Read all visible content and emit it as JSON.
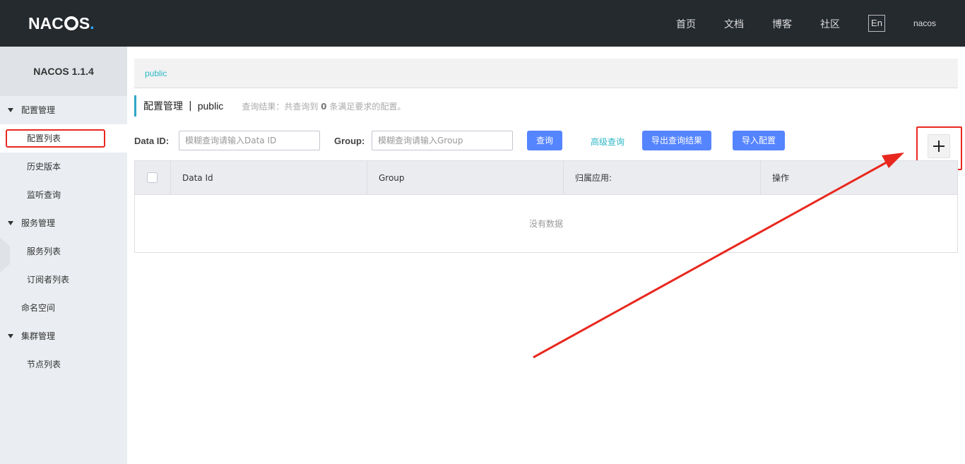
{
  "header": {
    "logo": {
      "n": "N",
      "a": "A",
      "c": "C",
      "s": "S",
      "dot": "."
    },
    "nav": [
      "首页",
      "文档",
      "博客",
      "社区"
    ],
    "lang": "En",
    "user": "nacos"
  },
  "sidebar": {
    "title": "NACOS 1.1.4",
    "items": [
      {
        "label": "配置管理",
        "type": "group"
      },
      {
        "label": "配置列表",
        "type": "sub",
        "active": true
      },
      {
        "label": "历史版本",
        "type": "sub"
      },
      {
        "label": "监听查询",
        "type": "sub"
      },
      {
        "label": "服务管理",
        "type": "group"
      },
      {
        "label": "服务列表",
        "type": "sub"
      },
      {
        "label": "订阅者列表",
        "type": "sub"
      },
      {
        "label": "命名空间",
        "type": "plain"
      },
      {
        "label": "集群管理",
        "type": "group"
      },
      {
        "label": "节点列表",
        "type": "sub"
      }
    ]
  },
  "main": {
    "namespace_tab": "public",
    "title": "配置管理",
    "separator": "|",
    "namespace": "public",
    "result_prefix": "查询结果：共查询到",
    "result_count": "0",
    "result_suffix": "条满足要求的配置。",
    "filters": {
      "dataid_label": "Data ID:",
      "dataid_placeholder": "模糊查询请输入Data ID",
      "group_label": "Group:",
      "group_placeholder": "模糊查询请输入Group",
      "query_button": "查询",
      "advanced_link": "高级查询",
      "export_button": "导出查询结果",
      "import_button": "导入配置"
    },
    "table": {
      "columns": [
        "Data Id",
        "Group",
        "归属应用:",
        "操作"
      ],
      "empty_text": "没有数据"
    }
  },
  "colors": {
    "header_bg": "#252a2f",
    "accent_blue": "#5584ff",
    "link_teal": "#2db7c7",
    "annotation_red": "#e8281f"
  }
}
